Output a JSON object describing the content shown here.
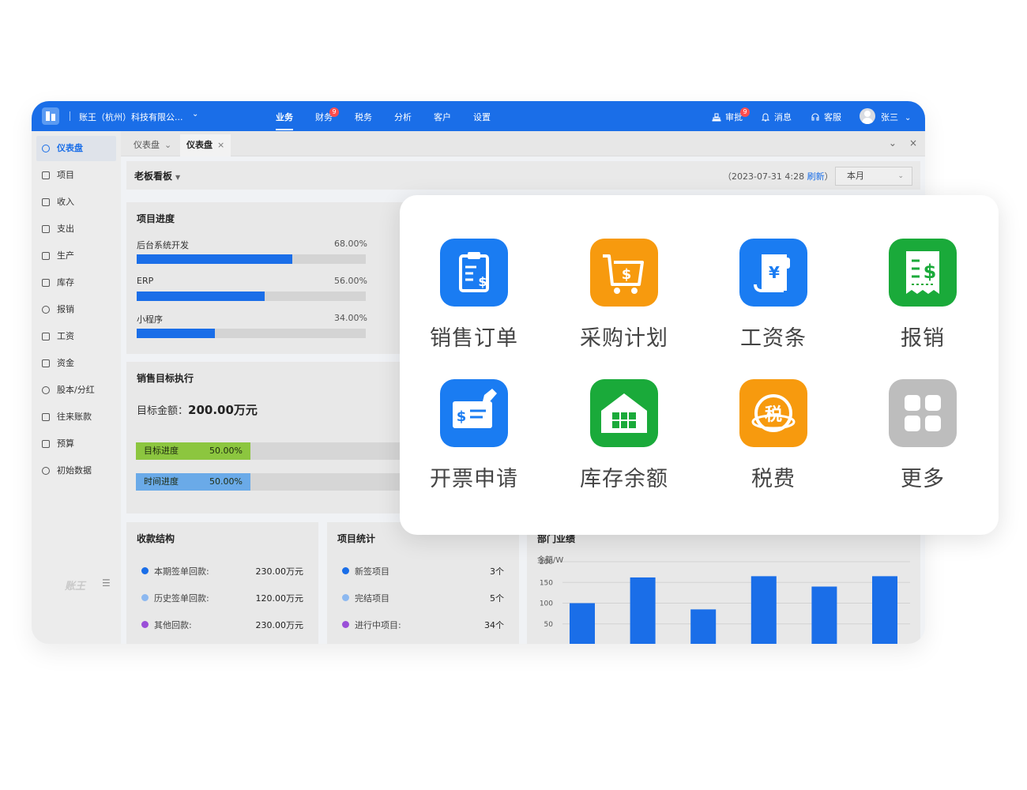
{
  "topbar": {
    "company": "账王（杭州）科技有限公...",
    "nav": [
      {
        "label": "业务",
        "active": true
      },
      {
        "label": "财务",
        "badge": "9"
      },
      {
        "label": "税务"
      },
      {
        "label": "分析"
      },
      {
        "label": "客户"
      },
      {
        "label": "设置"
      }
    ],
    "approve": "审批",
    "approve_badge": "9",
    "messages": "消息",
    "service": "客服",
    "user": "张三"
  },
  "sidebar": {
    "items": [
      {
        "label": "仪表盘",
        "icon": "dashboard-icon",
        "active": true
      },
      {
        "label": "项目",
        "icon": "folder-icon"
      },
      {
        "label": "收入",
        "icon": "income-icon"
      },
      {
        "label": "支出",
        "icon": "expense-icon"
      },
      {
        "label": "生产",
        "icon": "factory-icon"
      },
      {
        "label": "库存",
        "icon": "box-icon"
      },
      {
        "label": "报销",
        "icon": "coin-icon"
      },
      {
        "label": "工资",
        "icon": "wallet-icon"
      },
      {
        "label": "资金",
        "icon": "card-icon"
      },
      {
        "label": "股本/分红",
        "icon": "clock-icon"
      },
      {
        "label": "往来账款",
        "icon": "ledger-icon"
      },
      {
        "label": "预算",
        "icon": "budget-icon"
      },
      {
        "label": "初始数据",
        "icon": "database-icon"
      }
    ],
    "footer_logo": "账王",
    "footer_menu": "☰"
  },
  "tabs": [
    {
      "label": "仪表盘"
    },
    {
      "label": "仪表盘",
      "active": true
    }
  ],
  "board": {
    "title": "老板看板",
    "time_prefix": "（2023-07-31 4:28 ",
    "refresh": "刷新",
    "time_suffix": "）",
    "period": "本月"
  },
  "project_progress": {
    "title": "项目进度",
    "items": [
      {
        "name": "后台系统开发",
        "pct_text": "68.00%",
        "pct": 0.68
      },
      {
        "name": "ERP",
        "pct_text": "56.00%",
        "pct": 0.56
      },
      {
        "name": "小程序",
        "pct_text": "34.00%",
        "pct": 0.34
      }
    ]
  },
  "sales_target": {
    "title": "销售目标执行",
    "amount_label": "目标金额：",
    "amount_value": "200.00万元",
    "bars": [
      {
        "label": "目标进度",
        "value": "50.00%",
        "pct": 0.5,
        "color": "#8cc63f"
      },
      {
        "label": "时间进度",
        "value": "50.00%",
        "pct": 0.5,
        "color": "#6aaae8"
      }
    ]
  },
  "receipts": {
    "title": "收款结构",
    "rows": [
      {
        "name": "本期签单回款:",
        "value": "230.00万元",
        "color": "#1a6ee8"
      },
      {
        "name": "历史签单回款:",
        "value": "120.00万元",
        "color": "#8cb8f0"
      },
      {
        "name": "其他回款:",
        "value": "230.00万元",
        "color": "#9a4fd8"
      }
    ]
  },
  "project_stats": {
    "title": "项目统计",
    "rows": [
      {
        "name": "新签项目",
        "value": "3个",
        "color": "#1a6ee8"
      },
      {
        "name": "完结项目",
        "value": "5个",
        "color": "#8cb8f0"
      },
      {
        "name": "进行中项目:",
        "value": "34个",
        "color": "#9a4fd8"
      }
    ]
  },
  "dept_chart": {
    "title": "部门业绩",
    "unit": "金额/W"
  },
  "chart_data": {
    "type": "bar",
    "title": "部门业绩",
    "ylabel": "金额/W",
    "y_ticks": [
      50,
      100,
      150,
      200
    ],
    "ylim": [
      0,
      200
    ],
    "values": [
      100,
      162,
      85,
      165,
      140,
      165
    ],
    "color": "#1a6ee8",
    "grid": true
  },
  "quick_apps": [
    {
      "label": "销售订单",
      "icon": "clipboard-icon",
      "color": "#1a7cf2"
    },
    {
      "label": "采购计划",
      "icon": "cart-icon",
      "color": "#f79a0e"
    },
    {
      "label": "工资条",
      "icon": "payslip-icon",
      "color": "#1a7cf2"
    },
    {
      "label": "报销",
      "icon": "receipt-icon",
      "color": "#1aaa3a"
    },
    {
      "label": "开票申请",
      "icon": "invoice-icon",
      "color": "#1a7cf2"
    },
    {
      "label": "库存余额",
      "icon": "warehouse-icon",
      "color": "#1aaa3a"
    },
    {
      "label": "税费",
      "icon": "tax-icon",
      "color": "#f79a0e"
    },
    {
      "label": "更多",
      "icon": "grid-icon",
      "color": "#bdbdbd"
    }
  ]
}
